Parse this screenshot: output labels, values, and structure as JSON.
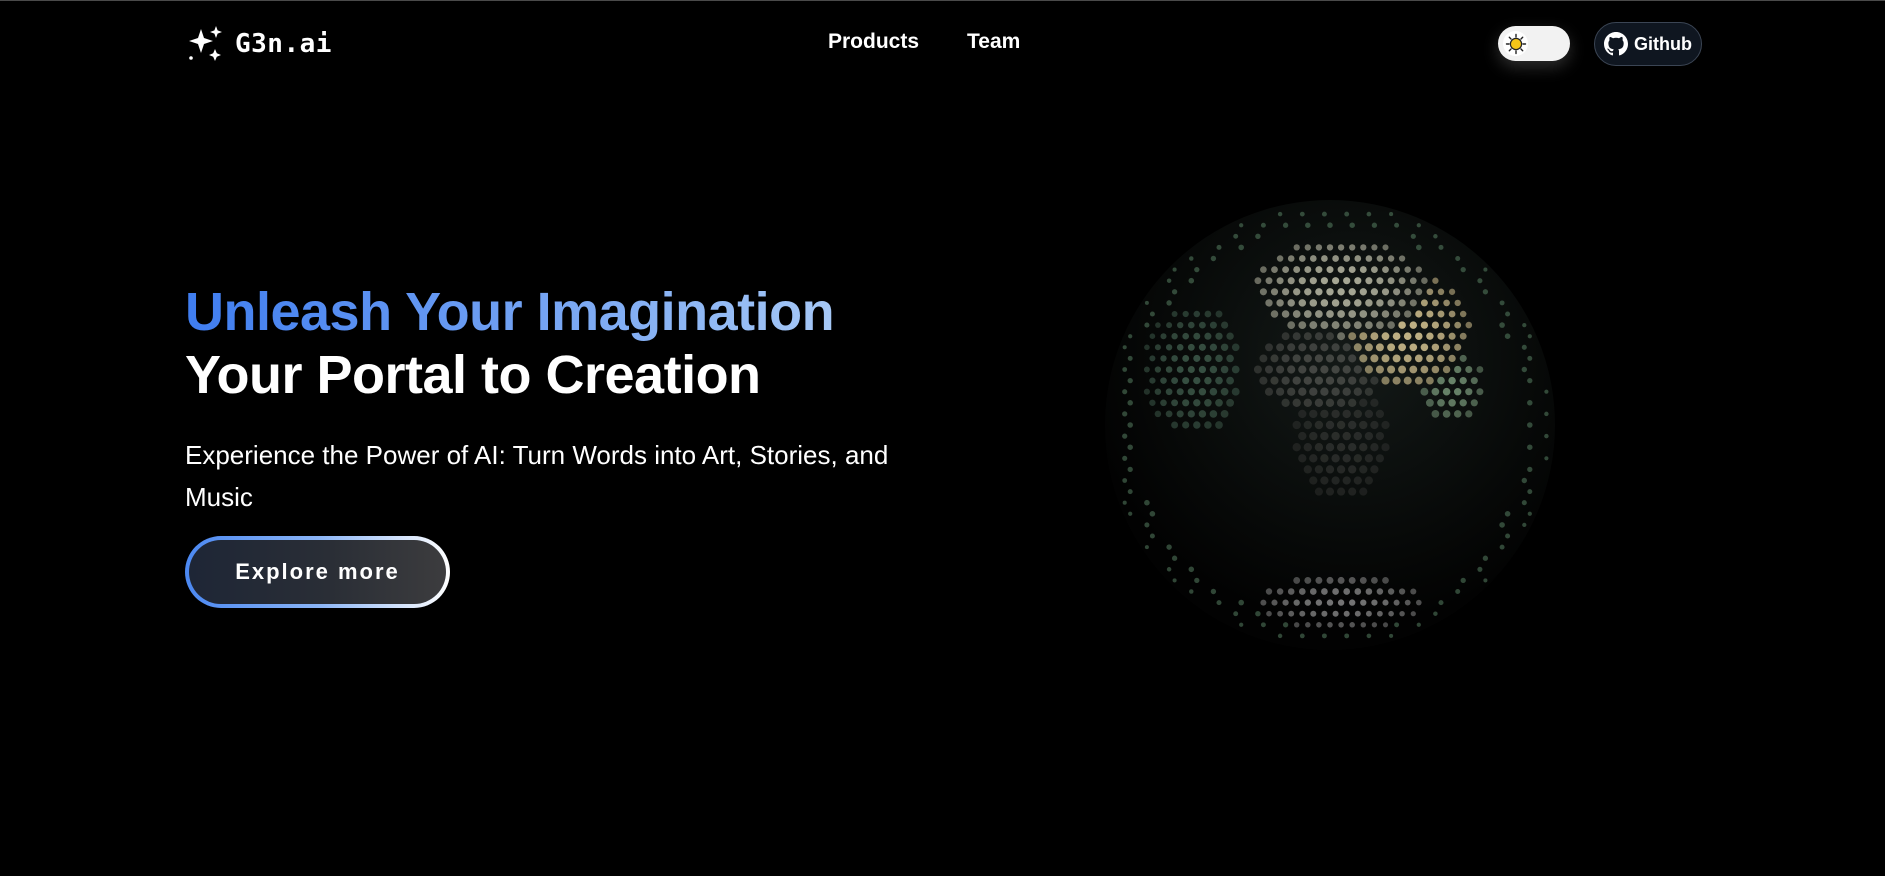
{
  "header": {
    "logo_text": "G3n.ai",
    "nav": [
      {
        "label": "Products"
      },
      {
        "label": "Team"
      }
    ],
    "github_label": "Github"
  },
  "hero": {
    "headline_line1": "Unleash Your Imagination",
    "headline_line2": "Your Portal to Creation",
    "subtitle": "Experience the Power of AI: Turn Words into Art, Stories, and Music",
    "cta_label": "Explore more"
  },
  "icons": {
    "logo": "sparkles-icon",
    "theme": "sun-icon",
    "github": "github-icon",
    "globe": "dotted-globe"
  },
  "colors": {
    "background": "#000000",
    "headline_gradient_start": "#3f7df0",
    "headline_gradient_end": "#a6c8f6",
    "text": "#ffffff",
    "sun": "#f5c518"
  }
}
